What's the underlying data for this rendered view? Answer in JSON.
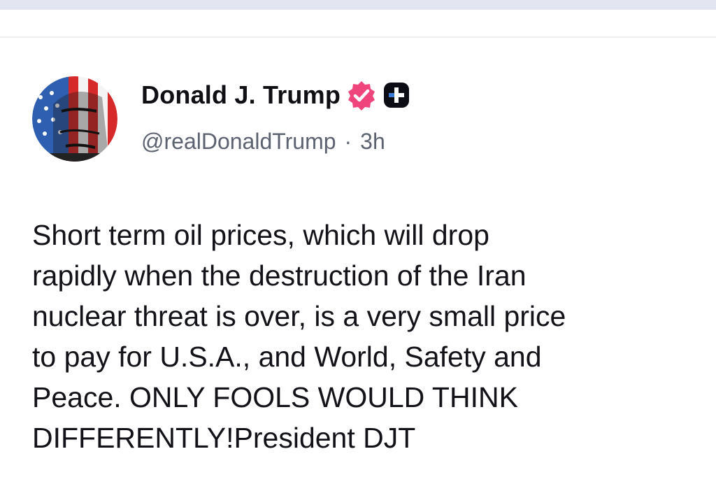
{
  "post": {
    "author": {
      "display_name": "Donald J. Trump",
      "handle": "@realDonaldTrump",
      "verified_icon": "verified-badge-icon",
      "plus_icon": "plus-badge-icon",
      "verified_color": "#f0457c"
    },
    "separator": "·",
    "timestamp": "3h",
    "lines": [
      "Short term oil prices, which will drop",
      "rapidly when the destruction of the Iran",
      "nuclear threat is over, is a very small price",
      "to pay for U.S.A., and World, Safety and",
      "Peace. ONLY FOOLS WOULD THINK",
      "DIFFERENTLY!President DJT"
    ]
  }
}
